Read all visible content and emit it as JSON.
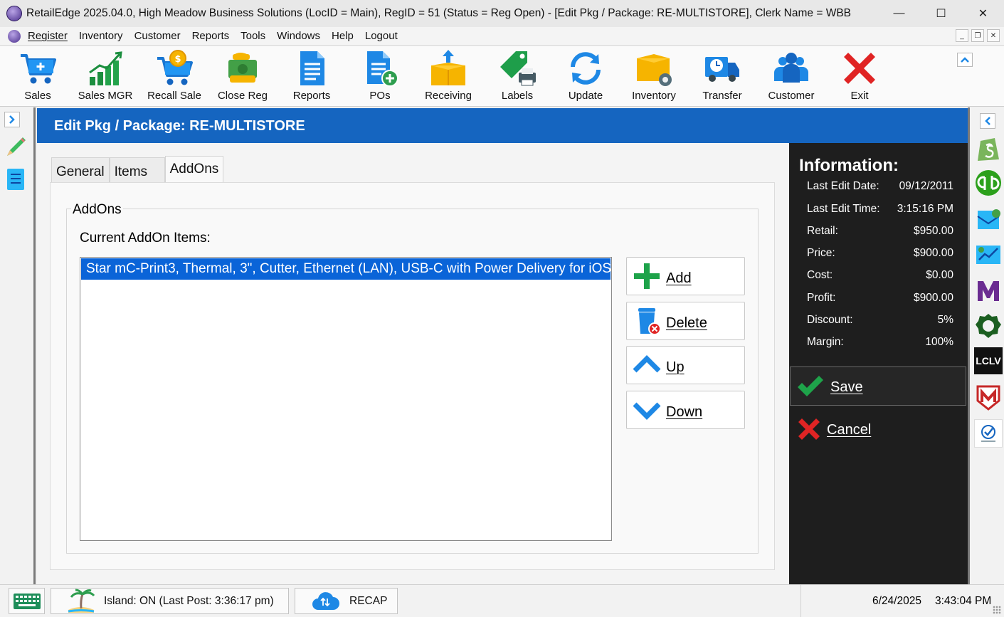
{
  "window": {
    "title": "RetailEdge 2025.04.0,  High Meadow Business Solutions (LocID = Main),  RegID = 51 (Status = Reg Open) - [Edit Pkg / Package: RE-MULTISTORE],  Clerk Name = WBB",
    "controls": {
      "minimize": "—",
      "maximize": "☐",
      "close": "✕"
    }
  },
  "menu": {
    "items": [
      "Register",
      "Inventory",
      "Customer",
      "Reports",
      "Tools",
      "Windows",
      "Help",
      "Logout"
    ],
    "mdi": {
      "minimize": "_",
      "restore": "❐",
      "close": "✕"
    }
  },
  "toolbar": {
    "buttons": [
      {
        "label": "Sales",
        "icon": "cart-plus-icon"
      },
      {
        "label": "Sales MGR",
        "icon": "growth-chart-icon"
      },
      {
        "label": "Recall Sale",
        "icon": "cart-coin-icon"
      },
      {
        "label": "Close Reg",
        "icon": "cash-hand-icon"
      },
      {
        "label": "Reports",
        "icon": "report-document-icon"
      },
      {
        "label": "POs",
        "icon": "document-add-icon"
      },
      {
        "label": "Receiving",
        "icon": "box-up-arrow-icon"
      },
      {
        "label": "Labels",
        "icon": "tag-printer-icon"
      },
      {
        "label": "Update",
        "icon": "sync-icon"
      },
      {
        "label": "Inventory",
        "icon": "box-gear-icon"
      },
      {
        "label": "Transfer",
        "icon": "truck-clock-icon"
      },
      {
        "label": "Customer",
        "icon": "people-icon"
      },
      {
        "label": "Exit",
        "icon": "red-x-icon"
      }
    ]
  },
  "header": {
    "title": "Edit Pkg / Package: RE-MULTISTORE"
  },
  "tabs": [
    {
      "label": "General",
      "active": false
    },
    {
      "label": "Items",
      "active": false
    },
    {
      "label": "AddOns",
      "active": true
    }
  ],
  "addons": {
    "group_title": "AddOns",
    "list_label": "Current AddOn Items:",
    "items": [
      "Star mC-Print3, Thermal, 3\", Cutter, Ethernet (LAN), USB-C with Power Delivery for iOS"
    ],
    "selected_index": 0,
    "buttons": {
      "add": "Add",
      "delete": "Delete",
      "up": "Up",
      "down": "Down"
    }
  },
  "info": {
    "title": "Information:",
    "rows": [
      {
        "label": "Last Edit Date:",
        "value": "09/12/2011"
      },
      {
        "label": "Last Edit Time:",
        "value": "3:15:16 PM"
      },
      {
        "label": "Retail:",
        "value": "$950.00"
      },
      {
        "label": "Price:",
        "value": "$900.00"
      },
      {
        "label": "Cost:",
        "value": "$0.00"
      },
      {
        "label": "Profit:",
        "value": "$900.00"
      },
      {
        "label": "Discount:",
        "value": "5%"
      },
      {
        "label": "Margin:",
        "value": "100%"
      }
    ],
    "save_label": "Save",
    "cancel_label": "Cancel"
  },
  "right_rail": {
    "icons": [
      "shopify-icon",
      "quickbooks-icon",
      "email-marketing-icon",
      "sales-chart-icon",
      "m-logo-icon",
      "gear-settings-icon",
      "lclv-icon",
      "m-shield-icon",
      "checkmark-badge-icon"
    ],
    "lclv_text": "LCLV"
  },
  "status": {
    "island": "Island: ON  (Last Post: 3:36:17 pm)",
    "recap": "RECAP",
    "date": "6/24/2025",
    "time": "3:43:04 PM"
  },
  "colors": {
    "header_blue": "#1565c0",
    "selection_blue": "#0a64d8",
    "info_bg": "#1e1e1e",
    "save_green": "#1ea34a",
    "cancel_red": "#e02424"
  }
}
